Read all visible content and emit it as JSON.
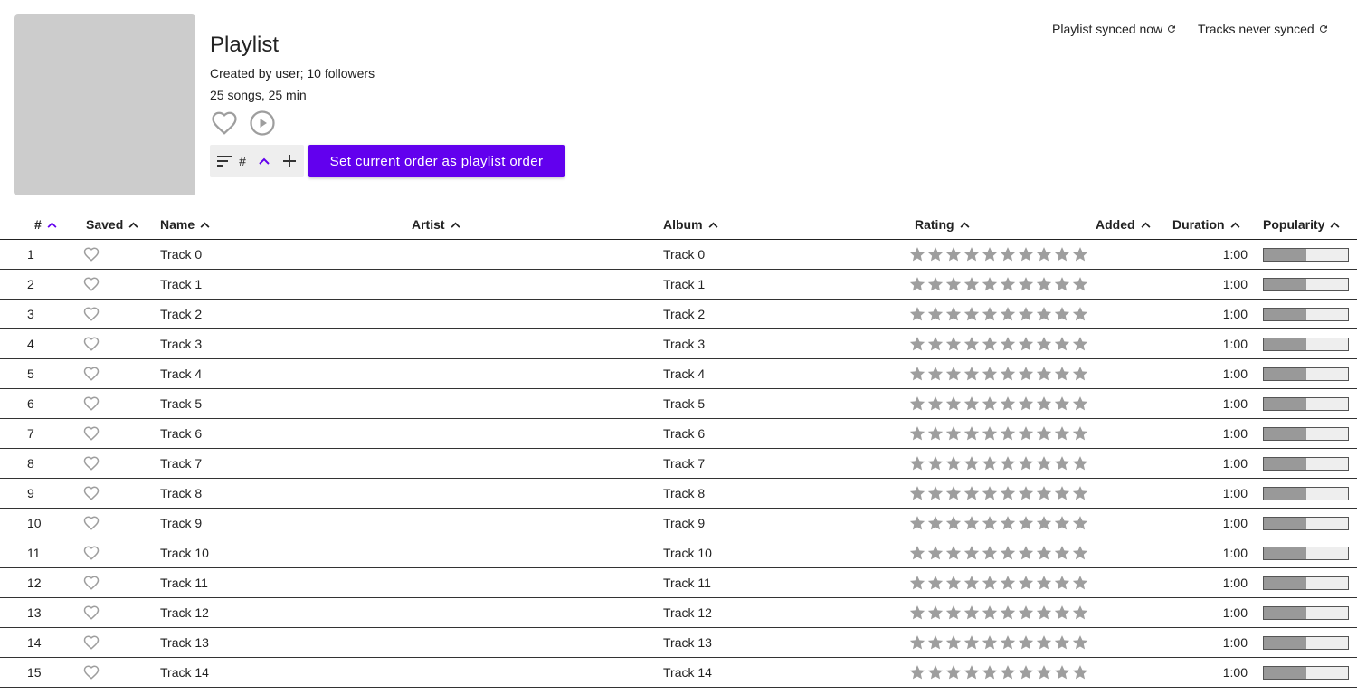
{
  "playlist": {
    "title": "Playlist",
    "created": "Created by user; 10 followers",
    "stats": "25 songs, 25 min"
  },
  "sort": {
    "field_label": "#",
    "set_order_label": "Set current order as playlist order"
  },
  "sync": {
    "playlist": "Playlist synced now",
    "tracks": "Tracks never synced"
  },
  "columns": {
    "num": "#",
    "saved": "Saved",
    "name": "Name",
    "artist": "Artist",
    "album": "Album",
    "rating": "Rating",
    "added": "Added",
    "duration": "Duration",
    "popularity": "Popularity"
  },
  "colors": {
    "accent": "#6200ee",
    "star": "#9e9e9e",
    "cover": "#cccccc"
  },
  "rating_max": 10,
  "tracks": [
    {
      "num": "1",
      "name": "Track 0",
      "album": "Track 0",
      "duration": "1:00",
      "popularity": 0.5
    },
    {
      "num": "2",
      "name": "Track 1",
      "album": "Track 1",
      "duration": "1:00",
      "popularity": 0.5
    },
    {
      "num": "3",
      "name": "Track 2",
      "album": "Track 2",
      "duration": "1:00",
      "popularity": 0.5
    },
    {
      "num": "4",
      "name": "Track 3",
      "album": "Track 3",
      "duration": "1:00",
      "popularity": 0.5
    },
    {
      "num": "5",
      "name": "Track 4",
      "album": "Track 4",
      "duration": "1:00",
      "popularity": 0.5
    },
    {
      "num": "6",
      "name": "Track 5",
      "album": "Track 5",
      "duration": "1:00",
      "popularity": 0.5
    },
    {
      "num": "7",
      "name": "Track 6",
      "album": "Track 6",
      "duration": "1:00",
      "popularity": 0.5
    },
    {
      "num": "8",
      "name": "Track 7",
      "album": "Track 7",
      "duration": "1:00",
      "popularity": 0.5
    },
    {
      "num": "9",
      "name": "Track 8",
      "album": "Track 8",
      "duration": "1:00",
      "popularity": 0.5
    },
    {
      "num": "10",
      "name": "Track 9",
      "album": "Track 9",
      "duration": "1:00",
      "popularity": 0.5
    },
    {
      "num": "11",
      "name": "Track 10",
      "album": "Track 10",
      "duration": "1:00",
      "popularity": 0.5
    },
    {
      "num": "12",
      "name": "Track 11",
      "album": "Track 11",
      "duration": "1:00",
      "popularity": 0.5
    },
    {
      "num": "13",
      "name": "Track 12",
      "album": "Track 12",
      "duration": "1:00",
      "popularity": 0.5
    },
    {
      "num": "14",
      "name": "Track 13",
      "album": "Track 13",
      "duration": "1:00",
      "popularity": 0.5
    },
    {
      "num": "15",
      "name": "Track 14",
      "album": "Track 14",
      "duration": "1:00",
      "popularity": 0.5
    }
  ]
}
